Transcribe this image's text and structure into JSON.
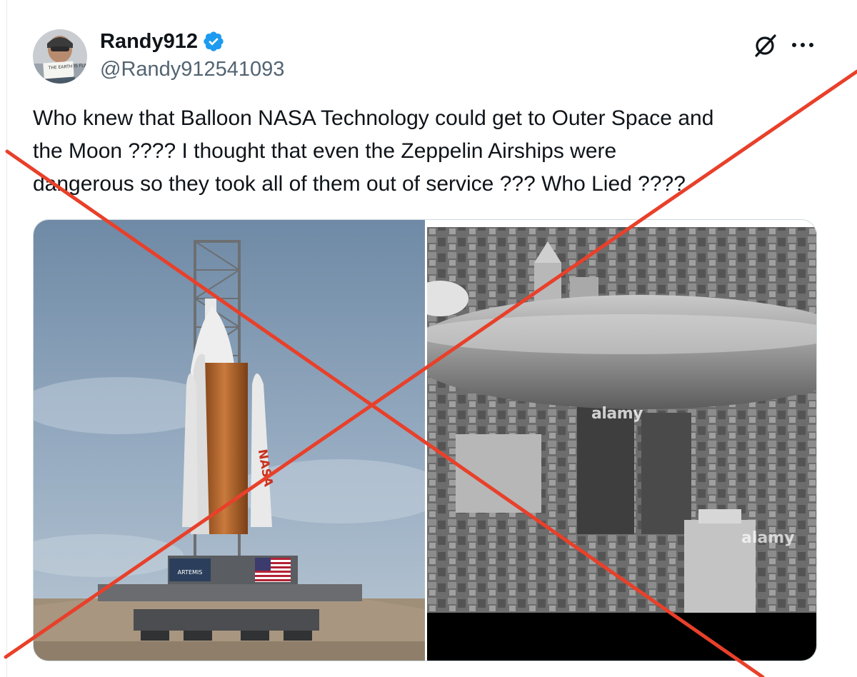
{
  "author": {
    "display_name": "Randy912",
    "handle": "@Randy912541093",
    "verified": true,
    "avatar_caption": "THE EARTH IS FLAT"
  },
  "post": {
    "text": "Who knew that Balloon NASA Technology could get to Outer Space and\nthe Moon ????   I thought that even the Zeppelin Airships were\ndangerous so they took all of them out of service ???  Who Lied ????"
  },
  "media": {
    "left_photo": {
      "subject": "rocket on launch pad",
      "booster_text": "NASA",
      "banner_text": "ARTEMIS"
    },
    "right_photo": {
      "subject": "zeppelin over city",
      "watermark": "alamy"
    }
  },
  "actions": {
    "grok_icon": "grok-icon",
    "more_icon": "more-icon"
  },
  "colors": {
    "text": "#0f1419",
    "secondary": "#536471",
    "verified": "#1d9bf0",
    "cross": "#e8402a"
  }
}
